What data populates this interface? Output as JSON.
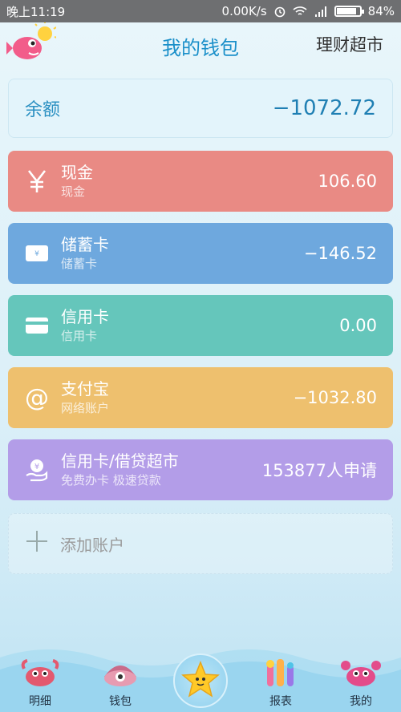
{
  "status_bar": {
    "time": "晚上11:19",
    "speed": "0.00K/s",
    "battery": "84%",
    "battery_level": 0.84
  },
  "header": {
    "title": "我的钱包",
    "right_link": "理财超市"
  },
  "balance": {
    "label": "余额",
    "value": "−1072.72"
  },
  "accounts": [
    {
      "name": "现金",
      "sub": "现金",
      "amount": "106.60",
      "icon": "yen-icon",
      "color": "#e98a84"
    },
    {
      "name": "储蓄卡",
      "sub": "储蓄卡",
      "amount": "−146.52",
      "icon": "bank-card-icon",
      "color": "#6ea8de"
    },
    {
      "name": "信用卡",
      "sub": "信用卡",
      "amount": "0.00",
      "icon": "credit-card-icon",
      "color": "#65c6bb"
    },
    {
      "name": "支付宝",
      "sub": "网络账户",
      "amount": "−1032.80",
      "icon": "at-icon",
      "color": "#eec06e"
    },
    {
      "name": "信用卡/借贷超市",
      "sub": "免费办卡 极速贷款",
      "amount": "153877人申请",
      "icon": "loan-hand-icon",
      "color": "#b39de8"
    }
  ],
  "add_account": {
    "label": "添加账户"
  },
  "tabs": [
    {
      "label": "明细",
      "icon": "crab-icon"
    },
    {
      "label": "钱包",
      "icon": "shell-icon"
    },
    {
      "label": "",
      "icon": "starfish-icon"
    },
    {
      "label": "报表",
      "icon": "coral-icon"
    },
    {
      "label": "我的",
      "icon": "crab-pink-icon"
    }
  ]
}
